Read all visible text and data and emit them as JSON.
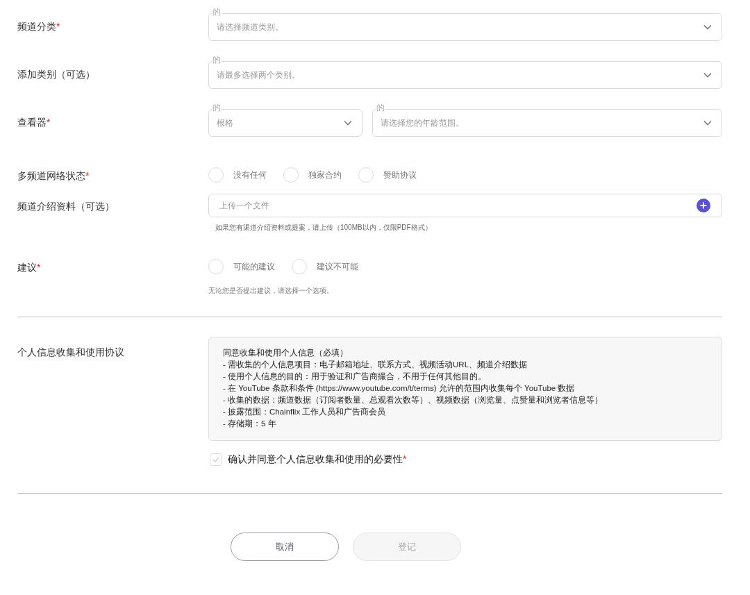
{
  "rows": [
    {
      "kind": "select",
      "label": "频道分类",
      "mark": "*",
      "selects": [
        {
          "legend": "的",
          "placeholder": "请选择频道类别。"
        }
      ]
    },
    {
      "kind": "select",
      "label": "添加类别（可选）",
      "selects": [
        {
          "legend": "的",
          "placeholder": "请最多选择两个类别。"
        }
      ]
    },
    {
      "kind": "select",
      "label": "查看器",
      "mark": "*",
      "selects": [
        {
          "legend": "的",
          "placeholder": "根格"
        },
        {
          "legend": "的",
          "placeholder": "请选择您的年龄范围。"
        }
      ]
    },
    {
      "kind": "radio",
      "label": "多频道网络状态",
      "mark": "*",
      "options": [
        {
          "label": "没有任何",
          "selected": false
        },
        {
          "label": "独家合约",
          "selected": false
        },
        {
          "label": "赞助协议",
          "selected": false
        }
      ]
    },
    {
      "kind": "upload",
      "label": "频道介绍资料（可选）",
      "placeholder": "上传一个文件",
      "hint": "如果您有渠道介绍资料或提案，请上传（100MB以内，仅限PDF格式）"
    },
    {
      "kind": "radio",
      "label": "建议",
      "mark": "*",
      "options": [
        {
          "label": "可能的建议",
          "selected": false
        },
        {
          "label": "建议不可能",
          "selected": false
        }
      ],
      "hint": "无论您是否提出建议，请选择一个选项。"
    }
  ],
  "agreement": {
    "label": "个人信息收集和使用协议",
    "lines": [
      "同意收集和使用个人信息（必填）",
      "- 需收集的个人信息项目：电子邮箱地址、联系方式、视频活动URL、频道介绍数据",
      "- 使用个人信息的目的：用于验证和广告商撮合，不用于任何其他目的。",
      "- 在 YouTube 条款和条件 (https://www.youtube.com/t/terms) 允许的范围内收集每个 YouTube 数据",
      "- 收集的数据：频道数据（订阅者数量、总观看次数等）、视频数据（浏览量、点赞量和浏览者信息等）",
      "- 披露范围：Chainflix 工作人员和广告商会员",
      "- 存储期：5 年"
    ],
    "checkbox": {
      "label": "确认并同意个人信息收集和使用的必要性",
      "mark": "*",
      "checked": false
    }
  },
  "buttons": [
    {
      "label": "取消",
      "kind": "secondary",
      "disabled": false
    },
    {
      "label": "登记",
      "kind": "primary",
      "disabled": true
    }
  ]
}
